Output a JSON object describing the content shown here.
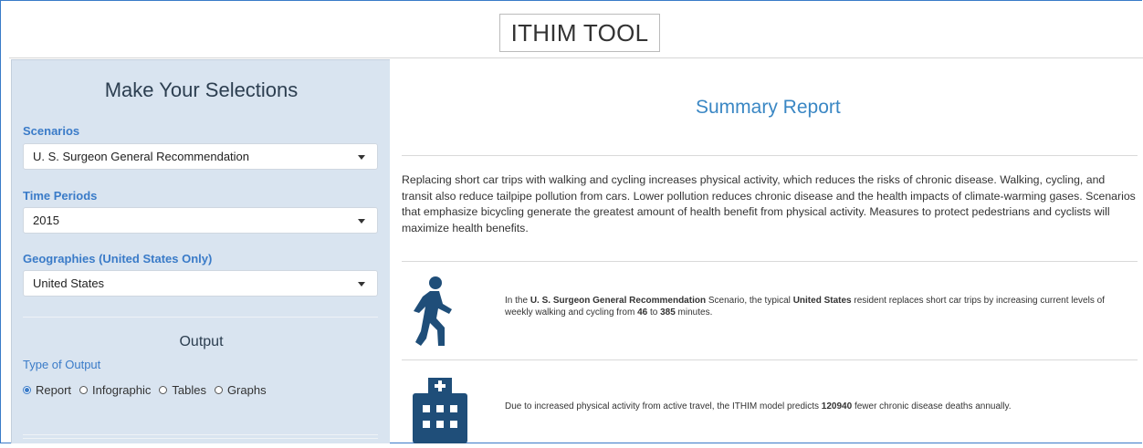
{
  "app": {
    "title": "ITHIM TOOL"
  },
  "sidebar": {
    "heading": "Make Your Selections",
    "scenarios": {
      "label": "Scenarios",
      "value": "U. S. Surgeon General Recommendation"
    },
    "time_periods": {
      "label": "Time Periods",
      "value": "2015"
    },
    "geographies": {
      "label": "Geographies (United States Only)",
      "value": "United States"
    },
    "output": {
      "heading": "Output",
      "type_label": "Type of Output",
      "options": [
        "Report",
        "Infographic",
        "Tables",
        "Graphs"
      ],
      "selected": "Report"
    }
  },
  "main": {
    "title": "Summary Report",
    "intro": "Replacing short car trips with walking and cycling increases physical activity, which reduces the risks of chronic disease. Walking, cycling, and transit also reduce tailpipe pollution from cars. Lower pollution reduces chronic disease and the health impacts of climate-warming gases. Scenarios that emphasize bicycling generate the greatest amount of health benefit from physical activity. Measures to protect pedestrians and cyclists will maximize health benefits.",
    "fact1": {
      "icon": "walking-person-icon",
      "pre": "In the ",
      "scenario": "U. S. Surgeon General Recommendation",
      "mid": " Scenario, the typical ",
      "place": "United States",
      "mid2": " resident replaces short car trips by increasing current levels of weekly walking and cycling from ",
      "from": "46",
      "to_word": " to ",
      "to": "385",
      "post": " minutes."
    },
    "fact2": {
      "icon": "hospital-icon",
      "pre": "Due to increased physical activity from active travel, the ITHIM model predicts ",
      "deaths": "120940",
      "post": " fewer chronic disease deaths annually."
    }
  },
  "colors": {
    "accent": "#3a7bc8",
    "sidebar_bg": "#d9e4f0",
    "icon": "#1f4e79"
  }
}
